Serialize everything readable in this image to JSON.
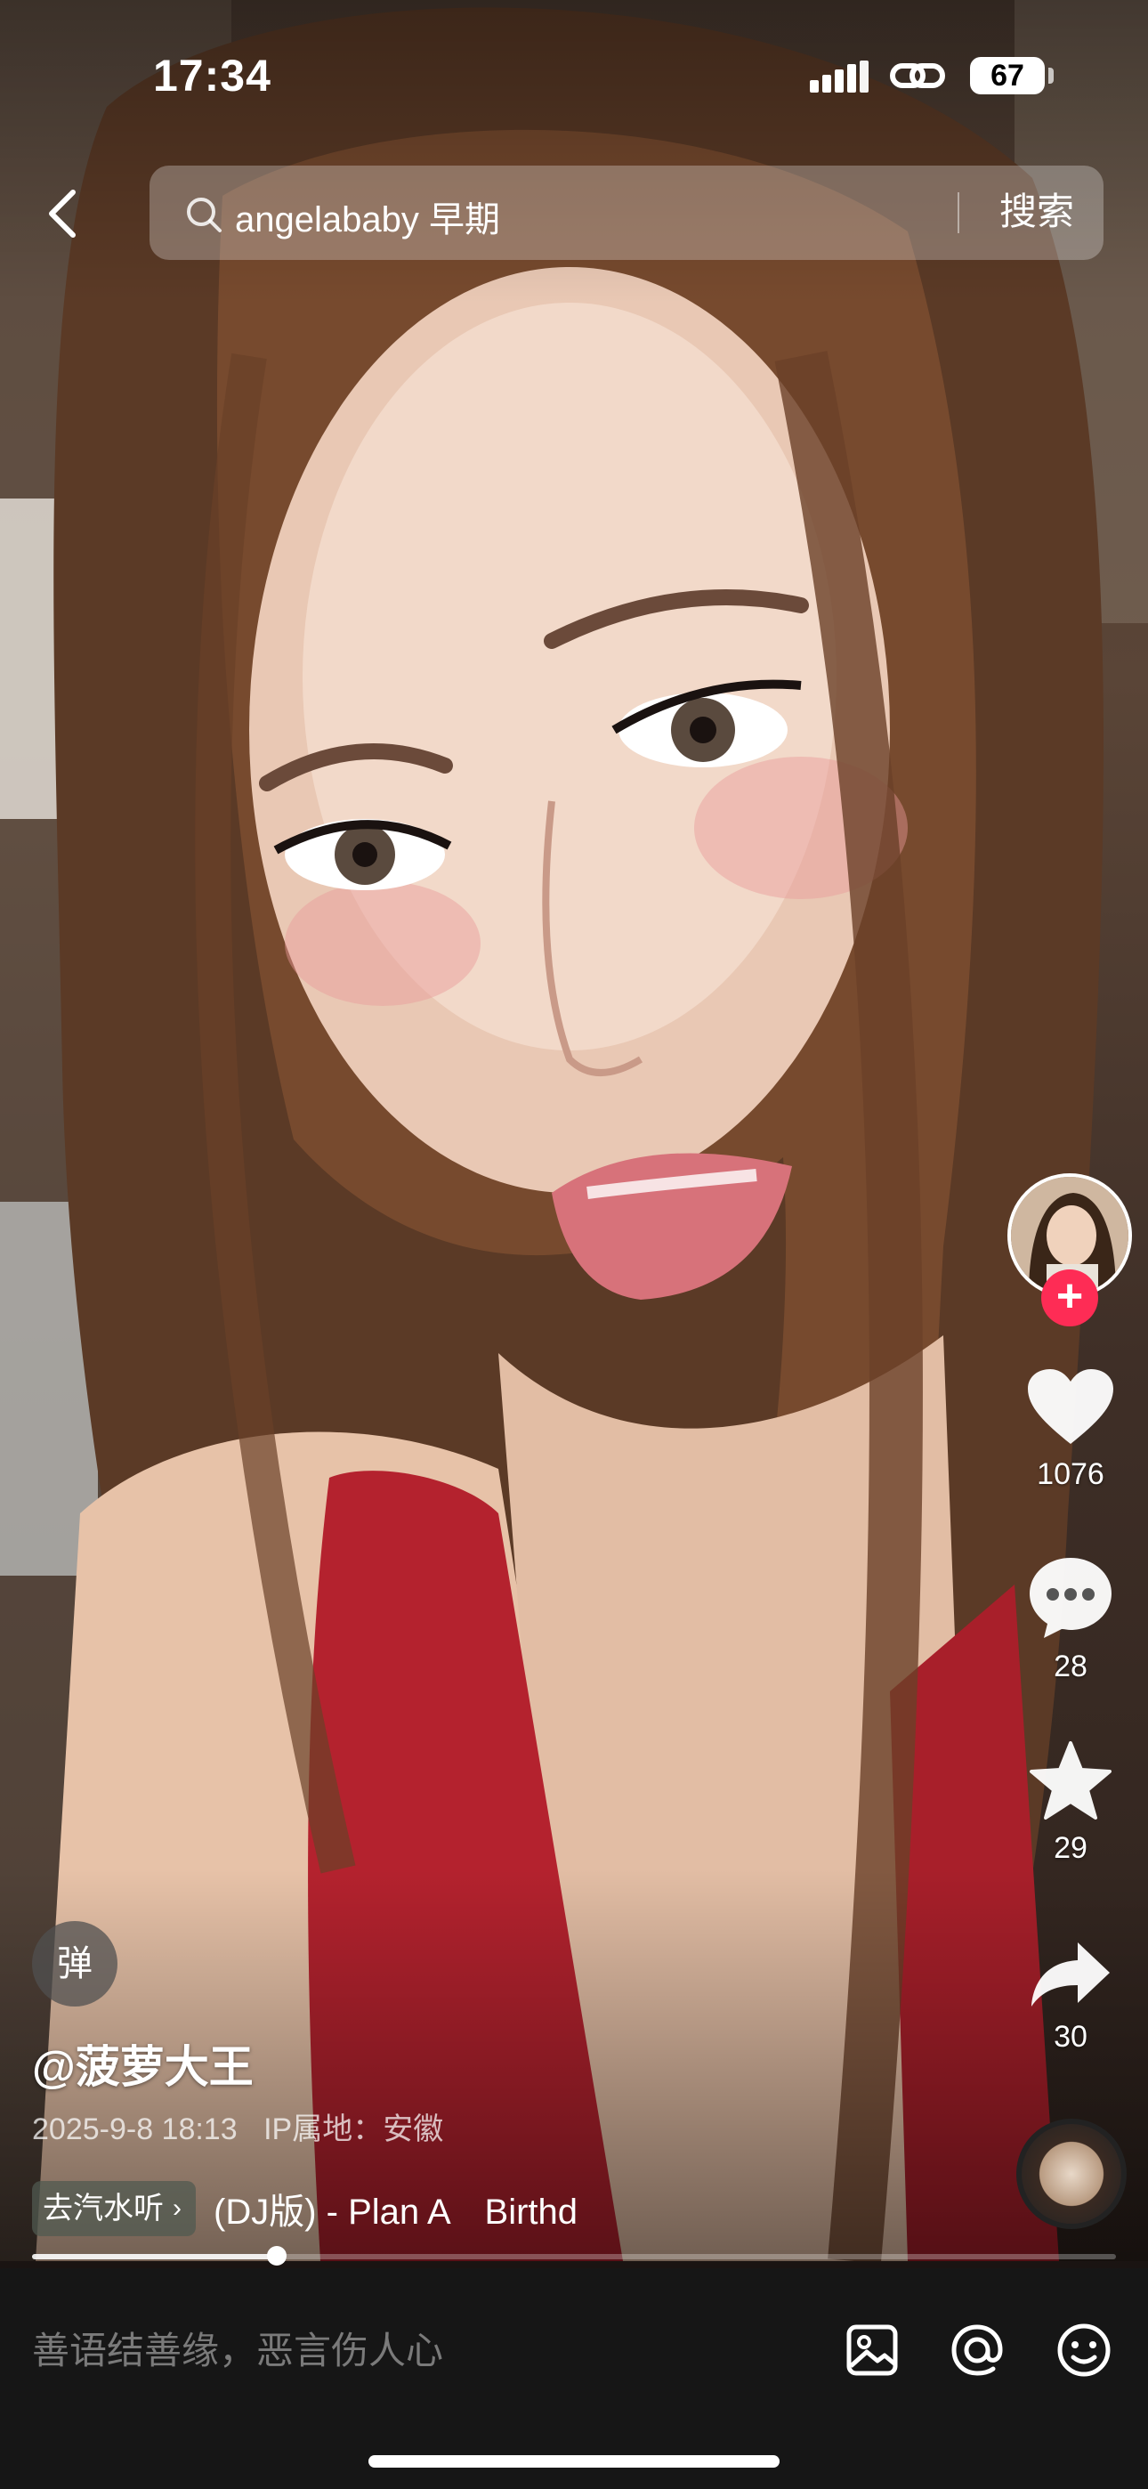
{
  "status_bar": {
    "time": "17:34",
    "battery": "67",
    "icons": [
      "cellular-signal-icon",
      "link-icon",
      "battery-icon"
    ]
  },
  "search": {
    "query": "angelababy 早期",
    "button_label": "搜索",
    "icons": [
      "back-chevron-icon",
      "search-icon"
    ]
  },
  "actions": {
    "follow_label": "+",
    "like_count": "1076",
    "comment_count": "28",
    "favorite_count": "29",
    "share_count": "30",
    "icons": [
      "heart-icon",
      "comment-bubble-icon",
      "star-icon",
      "share-arrow-icon",
      "music-disc-icon"
    ]
  },
  "post": {
    "danmu_label": "弹",
    "author": "@菠萝大王",
    "date": "2025-9-8 18:13",
    "ip_location": "IP属地：安徽",
    "soda_tag": "去汽水听",
    "soda_chevron": "›",
    "music_title": "(DJ版) - Plan A　Birthd"
  },
  "progress": {
    "fraction": 0.226
  },
  "comment_bar": {
    "placeholder": "善语结善缘，恶言伤人心",
    "icons": [
      "image-icon",
      "mention-at-icon",
      "emoji-icon"
    ]
  },
  "colors": {
    "accent_red": "#fe2c55",
    "comment_bar_bg": "#161616",
    "placeholder_gray": "#7a7a7a"
  }
}
